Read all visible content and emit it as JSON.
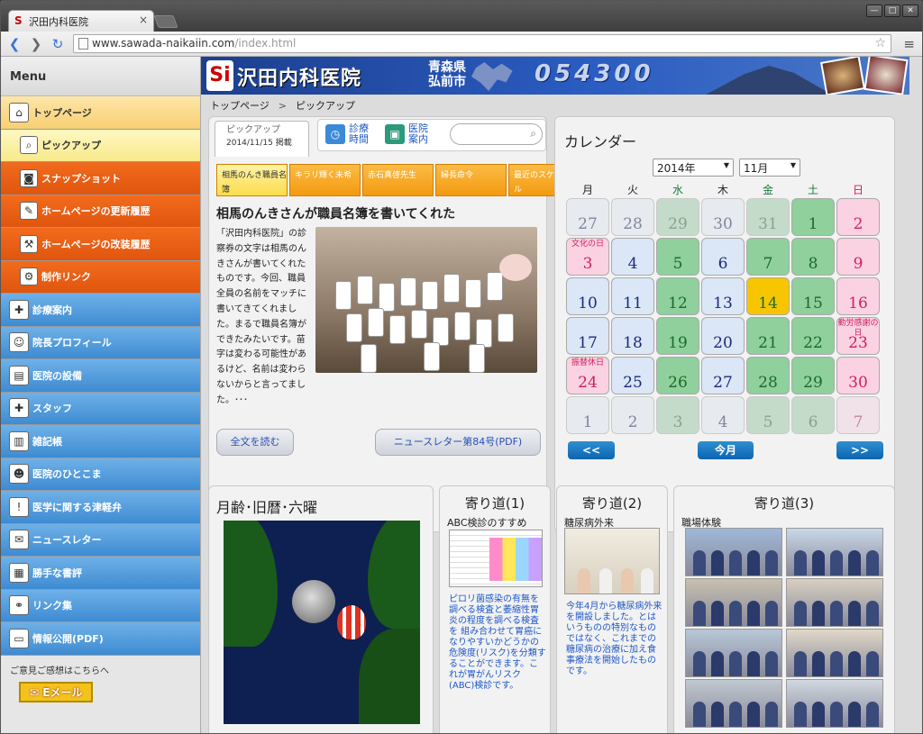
{
  "browser": {
    "tab_title": "沢田内科医院",
    "tab_close": "×",
    "url_host": "www.sawada-naikaiin.com",
    "url_path": "/index.html",
    "win_min": "—",
    "win_max": "□",
    "win_close": "✕",
    "back": "❮",
    "forward": "❯",
    "reload": "↻",
    "menu": "≡",
    "star": "☆"
  },
  "sidebar": {
    "title": "Menu",
    "items": [
      {
        "label": "トップページ",
        "icon": "house-icon"
      },
      {
        "label": "ピックアップ",
        "icon": "magnifier-icon"
      },
      {
        "label": "スナップショット",
        "icon": "camera-icon"
      },
      {
        "label": "ホームページの更新履歴",
        "icon": "brush-icon"
      },
      {
        "label": "ホームページの改装履歴",
        "icon": "hammer-icon"
      },
      {
        "label": "制作リンク",
        "icon": "gear-icon"
      },
      {
        "label": "診療案内",
        "icon": "clinic-icon"
      },
      {
        "label": "院長プロフィール",
        "icon": "doctor-icon"
      },
      {
        "label": "医院の設備",
        "icon": "equipment-icon"
      },
      {
        "label": "スタッフ",
        "icon": "nurse-icon"
      },
      {
        "label": "雑記帳",
        "icon": "notebook-icon"
      },
      {
        "label": "医院のひとこま",
        "icon": "people-icon"
      },
      {
        "label": "医学に関する津軽弁",
        "icon": "speech-icon"
      },
      {
        "label": "ニュースレター",
        "icon": "newsletter-icon"
      },
      {
        "label": "勝手な書評",
        "icon": "book-icon"
      },
      {
        "label": "リンク集",
        "icon": "link-icon"
      },
      {
        "label": "情報公開(PDF)",
        "icon": "document-icon"
      }
    ],
    "feedback": "ご意見ご感想はこちらへ",
    "email": "Eメール"
  },
  "banner": {
    "logo": "Si",
    "name": "沢田内科医院",
    "pref": "青森県",
    "city": "弘前市",
    "zip": "054300"
  },
  "breadcrumb": {
    "home": "トップページ",
    "sep": ">",
    "current": "ピックアップ"
  },
  "pickup": {
    "head_label": "ピックアップ",
    "head_date": "2014/11/15 掲載",
    "tab1": "診療時間",
    "tab2": "医院案内",
    "nav": [
      "相馬のんき職員名簿",
      "キラリ輝く未希",
      "赤石真啓先生",
      "婦長命令",
      "最近のスケジュール"
    ],
    "title": "相馬のんきさんが職員名簿を書いてくれた",
    "text": "「沢田内科医院」の診察券の文字は相馬のんきさんが書いてくれたものです。今回、職員全員の名前をマッチに書いてきてくれました。まるで職員名簿ができたみたいです。苗字は変わる可能性があるけど、名前は変わらないからと言ってました。･･･",
    "read_more": "全文を読む",
    "newsletter": "ニュースレター第84号(PDF)"
  },
  "calendar": {
    "title": "カレンダー",
    "year": "2014年",
    "month": "11月",
    "dow": [
      "月",
      "火",
      "水",
      "木",
      "金",
      "土",
      "日"
    ],
    "weeks": [
      [
        {
          "d": "27",
          "o": 1
        },
        {
          "d": "28",
          "o": 1
        },
        {
          "d": "29",
          "o": 1
        },
        {
          "d": "30",
          "o": 1
        },
        {
          "d": "31",
          "o": 1
        },
        {
          "d": "1"
        },
        {
          "d": "2"
        }
      ],
      [
        {
          "d": "3",
          "h": "文化の日"
        },
        {
          "d": "4"
        },
        {
          "d": "5"
        },
        {
          "d": "6"
        },
        {
          "d": "7"
        },
        {
          "d": "8"
        },
        {
          "d": "9"
        }
      ],
      [
        {
          "d": "10"
        },
        {
          "d": "11"
        },
        {
          "d": "12"
        },
        {
          "d": "13"
        },
        {
          "d": "14",
          "t": 1
        },
        {
          "d": "15"
        },
        {
          "d": "16"
        }
      ],
      [
        {
          "d": "17"
        },
        {
          "d": "18"
        },
        {
          "d": "19"
        },
        {
          "d": "20"
        },
        {
          "d": "21"
        },
        {
          "d": "22"
        },
        {
          "d": "23",
          "h": "勤労感謝の日"
        }
      ],
      [
        {
          "d": "24",
          "h": "振替休日"
        },
        {
          "d": "25"
        },
        {
          "d": "26"
        },
        {
          "d": "27"
        },
        {
          "d": "28"
        },
        {
          "d": "29"
        },
        {
          "d": "30"
        }
      ],
      [
        {
          "d": "1",
          "o": 1
        },
        {
          "d": "2",
          "o": 1
        },
        {
          "d": "3",
          "o": 1
        },
        {
          "d": "4",
          "o": 1
        },
        {
          "d": "5",
          "o": 1
        },
        {
          "d": "6",
          "o": 1
        },
        {
          "d": "7",
          "o": 1
        }
      ]
    ],
    "prev": "<<",
    "today": "今月",
    "next": ">>"
  },
  "lower": {
    "moon_title": "月齢･旧暦･六曜",
    "y1_title": "寄り道(1)",
    "y1_sub": "ABC検診のすすめ",
    "y1_text": "ピロリ菌感染の有無を調べる検査と萎縮性胃炎の程度を調べる検査を 組み合わせて胃癌になりやすいかどうかの危険度(リスク)を分類することができます。これが胃がんリスク(ABC)検診です。",
    "y2_title": "寄り道(2)",
    "y2_sub": "糖尿病外来",
    "y2_text": "今年4月から糖尿病外来を開設しました。とはいうものの特別なものではなく、これまでの糖尿病の治療に加え食事療法を開始したものです。",
    "y3_title": "寄り道(3)",
    "y3_sub": "職場体験"
  },
  "colors": {
    "orange": "#f26b1d",
    "blue": "#4a94da",
    "wednesday": "#8fd09c",
    "today": "#f7c600",
    "sunday": "#fbd2e2",
    "weekday": "#dbe6f7"
  }
}
